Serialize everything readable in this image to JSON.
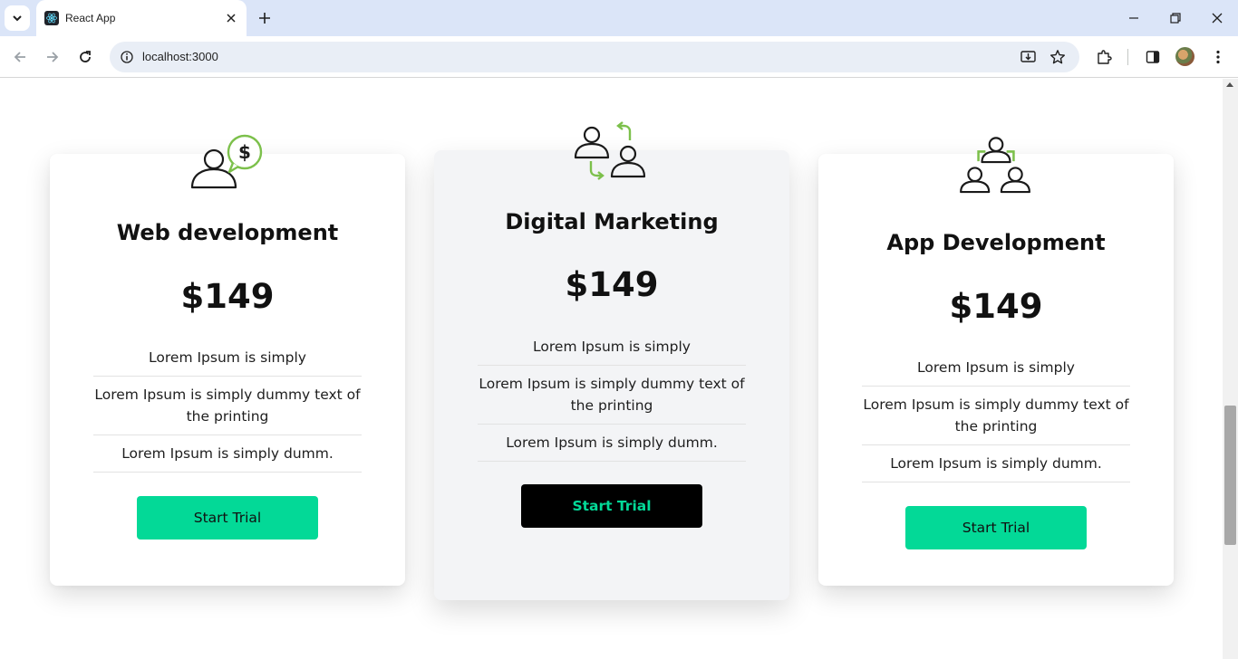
{
  "browser": {
    "tab_title": "React App",
    "url": "localhost:3000",
    "icons": {
      "tab_search": "chevron-down-icon",
      "favicon": "react-icon",
      "tab_close": "close-icon",
      "new_tab": "plus-icon",
      "minimize": "minimize-icon",
      "maximize": "restore-icon",
      "close": "close-icon",
      "back": "back-arrow-icon",
      "forward": "forward-arrow-icon",
      "reload": "reload-icon",
      "site_info": "info-icon",
      "install": "install-app-icon",
      "bookmark": "star-icon",
      "extensions": "puzzle-icon",
      "side_panel": "side-panel-icon",
      "menu": "kebab-menu-icon"
    }
  },
  "colors": {
    "accent": "#03d997",
    "icon_green": "#7cc04b",
    "gray_card": "#f3f4f6"
  },
  "cards": [
    {
      "title": "Web development",
      "price": "$149",
      "icon": "person-dollar-chat-icon",
      "features": [
        "Lorem Ipsum is simply",
        "Lorem Ipsum is simply dummy text of the printing",
        "Lorem Ipsum is simply dumm."
      ],
      "button": "Start Trial"
    },
    {
      "title": "Digital Marketing",
      "price": "$149",
      "icon": "people-exchange-icon",
      "features": [
        "Lorem Ipsum is simply",
        "Lorem Ipsum is simply dummy text of the printing",
        "Lorem Ipsum is simply dumm."
      ],
      "button": "Start Trial"
    },
    {
      "title": "App Development",
      "price": "$149",
      "icon": "team-group-icon",
      "features": [
        "Lorem Ipsum is simply",
        "Lorem Ipsum is simply dummy text of the printing",
        "Lorem Ipsum is simply dumm."
      ],
      "button": "Start Trial"
    }
  ]
}
